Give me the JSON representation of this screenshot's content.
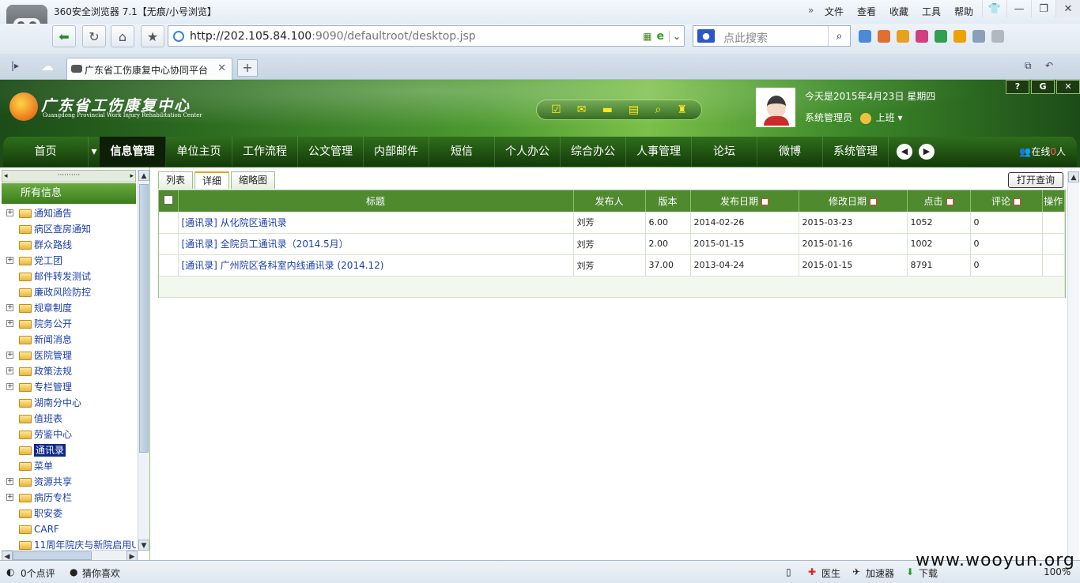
{
  "browser": {
    "title": "360安全浏览器 7.1【无痕/小号浏览】",
    "menu": [
      "文件",
      "查看",
      "收藏",
      "工具",
      "帮助"
    ],
    "url_host": "http://202.105.84.100",
    "url_rest": ":9090/defaultroot/desktop.jsp",
    "search_placeholder": "点此搜索",
    "tab_title": "广东省工伤康复中心协同平台",
    "new_tab": "+"
  },
  "header": {
    "logo_name": "广东省工伤康复中心",
    "logo_en": "Guangdong Provincial Work Injury Rehabilitation Center",
    "today": "今天是2015年4月23日  星期四",
    "user": "系统管理员",
    "status": "上班"
  },
  "nav": {
    "items": [
      "首页",
      "信息管理",
      "单位主页",
      "工作流程",
      "公文管理",
      "内部邮件",
      "短信",
      "个人办公",
      "综合办公",
      "人事管理",
      "论坛",
      "微博",
      "系统管理"
    ],
    "online_prefix": "在线",
    "online_count": "0",
    "online_suffix": "人"
  },
  "sidebar": {
    "top_dots": "··········",
    "heading": "所有信息",
    "tree": [
      {
        "label": "通知通告",
        "expandable": true
      },
      {
        "label": "病区查房通知",
        "expandable": false
      },
      {
        "label": "群众路线",
        "expandable": false
      },
      {
        "label": "党工团",
        "expandable": true
      },
      {
        "label": "邮件转发测试",
        "expandable": false
      },
      {
        "label": "廉政风险防控",
        "expandable": false
      },
      {
        "label": "规章制度",
        "expandable": true
      },
      {
        "label": "院务公开",
        "expandable": true
      },
      {
        "label": "新闻消息",
        "expandable": false
      },
      {
        "label": "医院管理",
        "expandable": true
      },
      {
        "label": "政策法规",
        "expandable": true
      },
      {
        "label": "专栏管理",
        "expandable": true
      },
      {
        "label": "湖南分中心",
        "expandable": false
      },
      {
        "label": "值班表",
        "expandable": false
      },
      {
        "label": "劳鉴中心",
        "expandable": false
      },
      {
        "label": "通讯录",
        "expandable": false,
        "selected": true
      },
      {
        "label": "菜单",
        "expandable": false
      },
      {
        "label": "资源共享",
        "expandable": true
      },
      {
        "label": "病历专栏",
        "expandable": true
      },
      {
        "label": "职安委",
        "expandable": false
      },
      {
        "label": "CARF",
        "expandable": false
      },
      {
        "label": "11周年院庆与新院启用U",
        "expandable": false
      }
    ]
  },
  "content": {
    "tabs": [
      "列表",
      "详细",
      "缩略图"
    ],
    "active_tab": "详细",
    "open_query": "打开查询",
    "columns": [
      "标题",
      "发布人",
      "版本",
      "发布日期",
      "修改日期",
      "点击",
      "评论",
      "操作"
    ],
    "rows": [
      {
        "title": "[通讯录]  从化院区通讯录",
        "author": "刘芳",
        "version": "6.00",
        "published": "2014-02-26",
        "modified": "2015-03-23",
        "clicks": "1052",
        "comments": "0"
      },
      {
        "title": "[通讯录]  全院员工通讯录（2014.5月）",
        "author": "刘芳",
        "version": "2.00",
        "published": "2015-01-15",
        "modified": "2015-01-16",
        "clicks": "1002",
        "comments": "0"
      },
      {
        "title": "[通讯录]  广州院区各科室内线通讯录 (2014.12)",
        "author": "刘芳",
        "version": "37.00",
        "published": "2013-04-24",
        "modified": "2015-01-15",
        "clicks": "8791",
        "comments": "0"
      }
    ]
  },
  "statusbar": {
    "comments": "0个点评",
    "guess": "猜你喜欢",
    "doctor": "医生",
    "accelerator": "加速器",
    "download": "下载",
    "zoom": "100%"
  },
  "watermark": "www.wooyun.org"
}
